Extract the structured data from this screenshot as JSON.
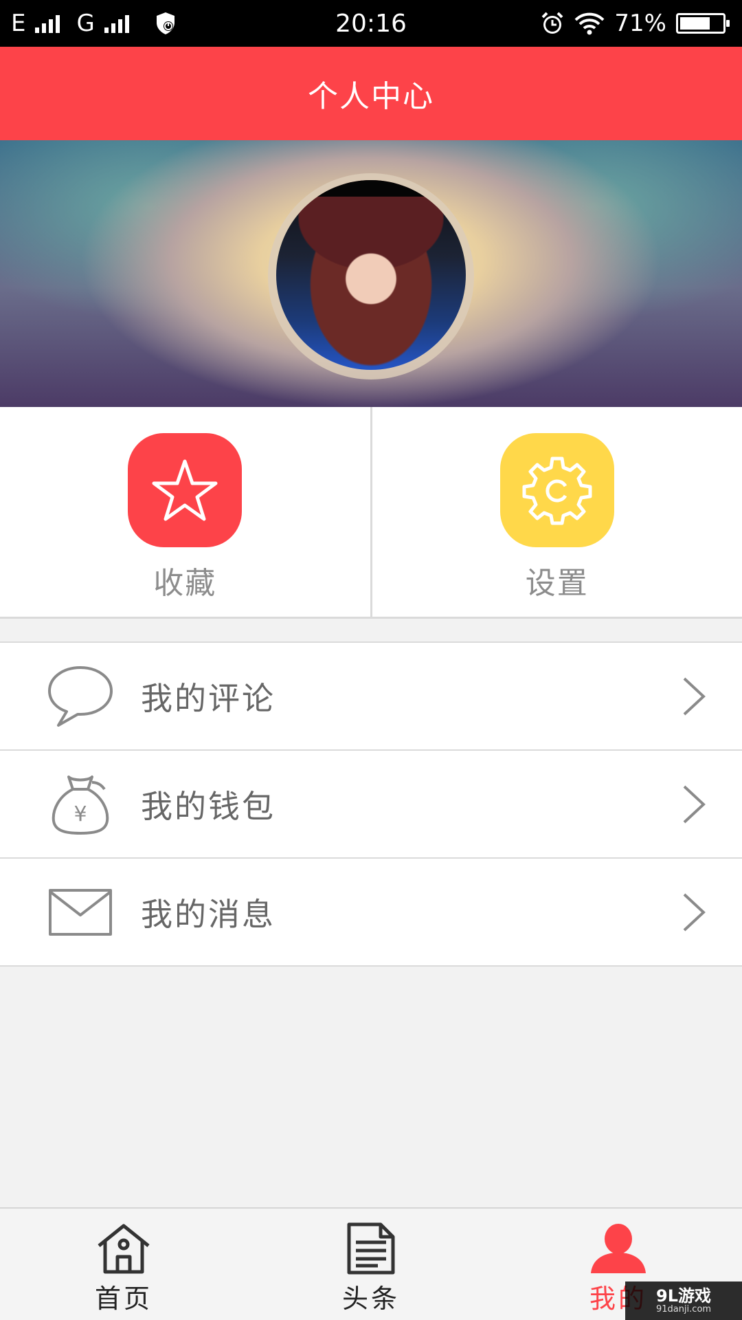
{
  "status_bar": {
    "network1": "E",
    "network2": "G",
    "time": "20:16",
    "battery_text": "71%",
    "battery_level": 0.71
  },
  "header": {
    "title": "个人中心"
  },
  "quick_actions": [
    {
      "label": "收藏",
      "icon": "star-icon",
      "color": "#fd4349"
    },
    {
      "label": "设置",
      "icon": "gear-icon",
      "color": "#ffd84a"
    }
  ],
  "menu": [
    {
      "label": "我的评论",
      "icon": "speech-bubble-icon"
    },
    {
      "label": "我的钱包",
      "icon": "money-bag-icon"
    },
    {
      "label": "我的消息",
      "icon": "envelope-icon"
    }
  ],
  "bottom_nav": [
    {
      "label": "首页",
      "icon": "home-icon",
      "active": false
    },
    {
      "label": "头条",
      "icon": "document-icon",
      "active": false
    },
    {
      "label": "我的",
      "icon": "user-icon",
      "active": true
    }
  ],
  "watermark": {
    "main": "9L游戏",
    "sub": "91danji.com"
  },
  "colors": {
    "accent": "#fd4349",
    "settings": "#ffd84a",
    "text_gray": "#8c8c8c"
  }
}
